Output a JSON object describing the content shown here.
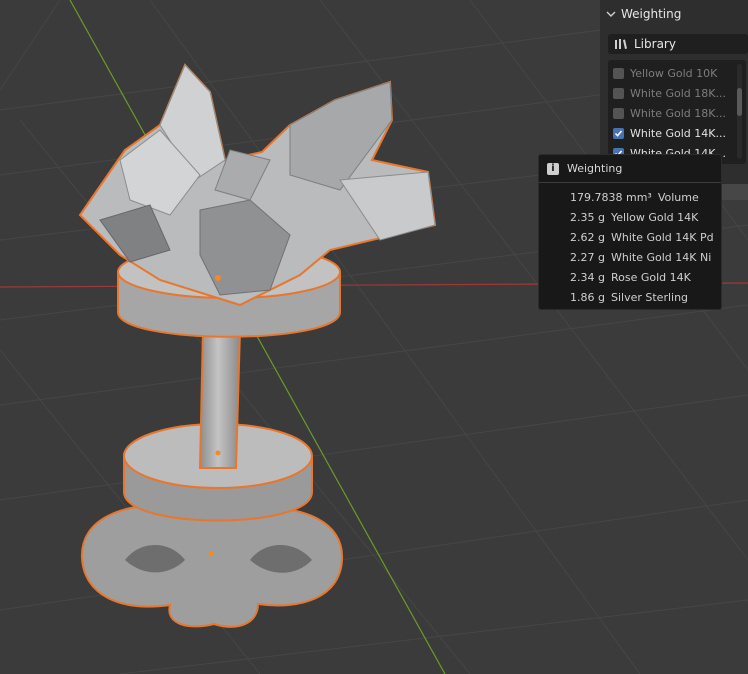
{
  "panel": {
    "header_label": "Weighting",
    "library_label": "Library",
    "items": [
      {
        "label": "Yellow Gold 10K",
        "checked": false
      },
      {
        "label": "White Gold 18K...",
        "checked": false
      },
      {
        "label": "White Gold 18K...",
        "checked": false
      },
      {
        "label": "White Gold 14K...",
        "checked": true
      },
      {
        "label": "White Gold 14K...",
        "checked": true
      }
    ]
  },
  "tooltip": {
    "title": "Weighting",
    "rows": [
      {
        "value": "179.7838 mm³",
        "name": "Volume"
      },
      {
        "value": "2.35 g",
        "name": "Yellow Gold 14K"
      },
      {
        "value": "2.62 g",
        "name": "White Gold 14K Pd"
      },
      {
        "value": "2.27 g",
        "name": "White Gold 14K Ni"
      },
      {
        "value": "2.34 g",
        "name": "Rose Gold 14K"
      },
      {
        "value": "1.86 g",
        "name": "Silver Sterling"
      }
    ]
  },
  "colors": {
    "accent": "#4772b3",
    "selection_outline": "#e8762d",
    "x_axis": "#9c3a3a",
    "y_axis": "#6a9a2a"
  },
  "icons": [
    "chevron-down-icon",
    "library-icon",
    "checkbox-icon",
    "info-icon"
  ]
}
